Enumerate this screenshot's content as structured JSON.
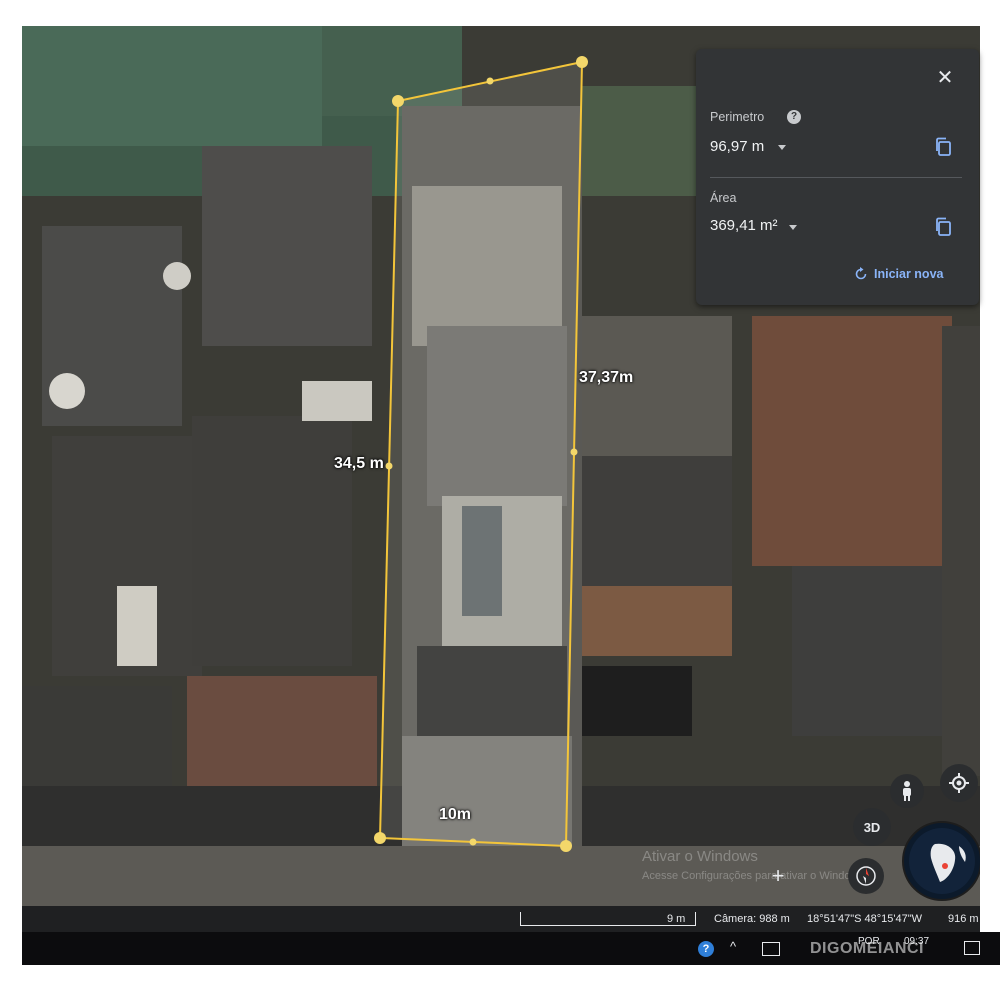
{
  "panel": {
    "perimeter_label": "Perimetro",
    "perimeter_value": "96,97 m",
    "area_label": "Área",
    "area_value": "369,41 m²",
    "new_button_label": "Iniciar nova",
    "help_glyph": "?",
    "close_glyph": "✕"
  },
  "measurements": {
    "left_side": "34,5 m",
    "right_side": "37,37m",
    "bottom_side": "10m"
  },
  "controls": {
    "three_d_label": "3D",
    "compass_icon": "compass-icon",
    "pegman_icon": "pegman-icon",
    "location_icon": "location-icon"
  },
  "status": {
    "scale": "9 m",
    "camera": "Câmera: 988 m",
    "coords": "18°51'47\"S 48°15'47\"W",
    "elevation": "916 m"
  },
  "watermark": {
    "line1": "Ativar o Windows",
    "line2": "Acesse Configurações para ativar o Windows."
  },
  "taskbar": {
    "lang": "POR",
    "time": "09:37",
    "brand": "DIGOMEIANCI"
  },
  "colors": {
    "polygon": "#f3c53a",
    "panel_bg": "#323436",
    "accent": "#8ab4f8"
  }
}
